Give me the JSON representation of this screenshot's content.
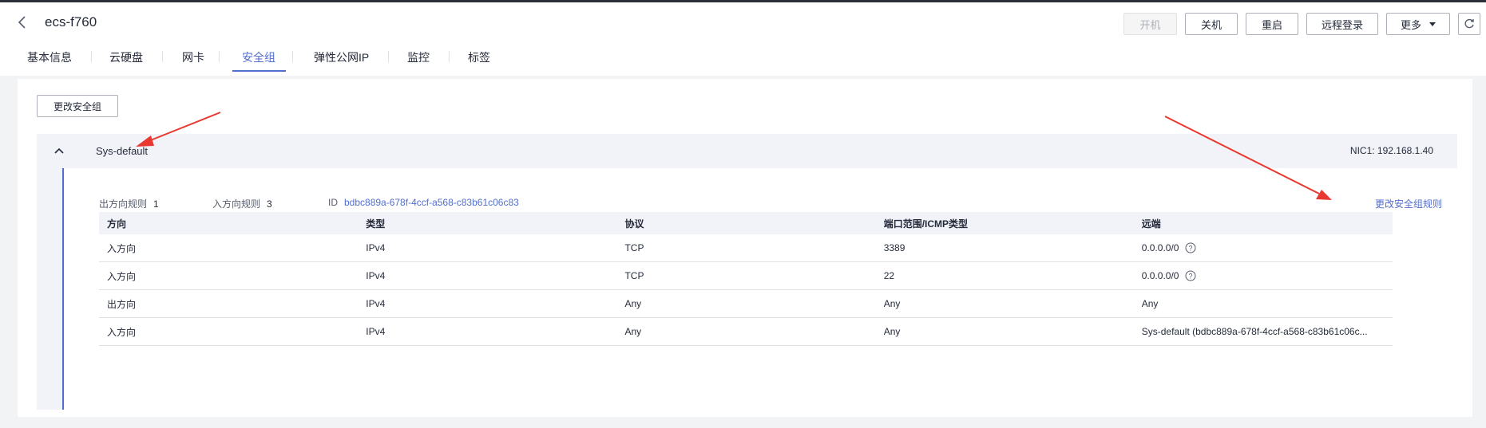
{
  "header": {
    "title": "ecs-f760",
    "buttons": {
      "start": "开机",
      "shutdown": "关机",
      "restart": "重启",
      "remote_login": "远程登录",
      "more": "更多"
    }
  },
  "tabs": [
    "基本信息",
    "云硬盘",
    "网卡",
    "安全组",
    "弹性公网IP",
    "监控",
    "标签"
  ],
  "active_tab": "安全组",
  "panel": {
    "change_sg_button": "更改安全组",
    "security_group": {
      "name": "Sys-default",
      "nic": "NIC1: 192.168.1.40",
      "outbound_label": "出方向规则",
      "outbound_count": "1",
      "inbound_label": "入方向规则",
      "inbound_count": "3",
      "id_label": "ID",
      "id_value": "bdbc889a-678f-4ccf-a568-c83b61c06c83",
      "edit_rules_link": "更改安全组规则"
    },
    "table": {
      "headers": [
        "方向",
        "类型",
        "协议",
        "端口范围/ICMP类型",
        "远端"
      ],
      "rows": [
        [
          "入方向",
          "IPv4",
          "TCP",
          "3389",
          "0.0.0.0/0"
        ],
        [
          "入方向",
          "IPv4",
          "TCP",
          "22",
          "0.0.0.0/0"
        ],
        [
          "出方向",
          "IPv4",
          "Any",
          "Any",
          "Any"
        ],
        [
          "入方向",
          "IPv4",
          "Any",
          "Any",
          "Sys-default (bdbc889a-678f-4ccf-a568-c83b61c06c..."
        ]
      ],
      "help_on_rows": [
        0,
        1
      ]
    }
  },
  "colors": {
    "accent": "#526ecc",
    "annotation_arrow": "#e8382f"
  }
}
